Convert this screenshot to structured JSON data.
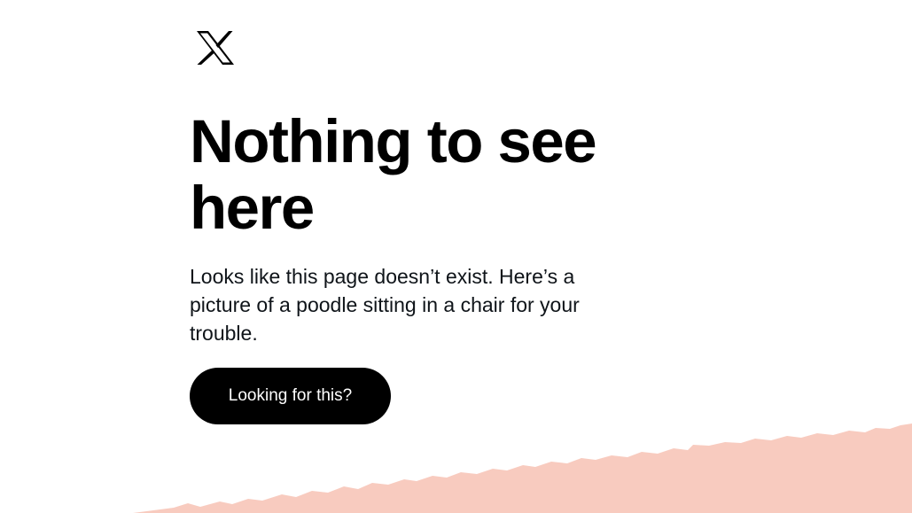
{
  "logo": {
    "icon": "x-logo-icon"
  },
  "main": {
    "headline": "Nothing to see here",
    "message": "Looks like this page doesn’t exist. Here’s a picture of a poodle sitting in a chair for your trouble.",
    "cta_label": "Looking for this?"
  },
  "colors": {
    "background": "#ffffff",
    "text": "#000000",
    "button_bg": "#000000",
    "button_text": "#ffffff",
    "accent_shape": "#f8cbbf"
  }
}
